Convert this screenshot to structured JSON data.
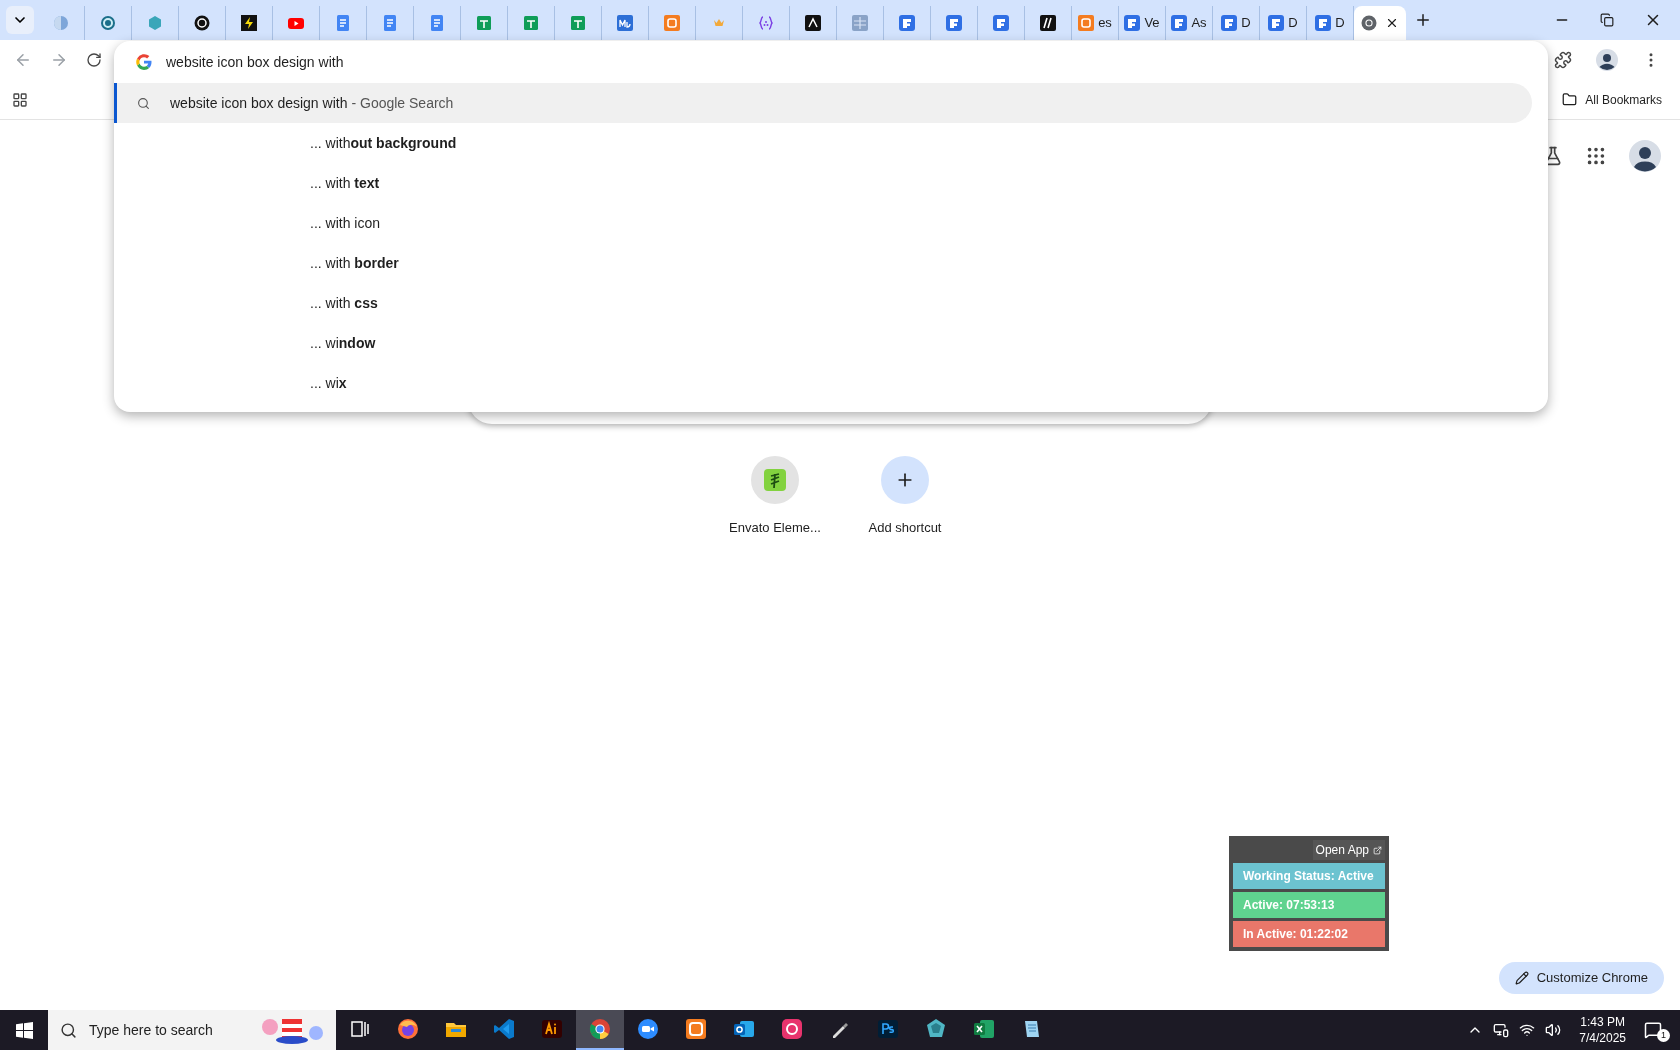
{
  "tabs": [
    {
      "kind": "globe",
      "selected": false
    },
    {
      "kind": "ring",
      "selected": false
    },
    {
      "kind": "hex",
      "selected": false
    },
    {
      "kind": "knot",
      "selected": false
    },
    {
      "kind": "bolt",
      "selected": false
    },
    {
      "kind": "video",
      "selected": false
    },
    {
      "kind": "doc",
      "selected": false
    },
    {
      "kind": "doc",
      "selected": false
    },
    {
      "kind": "doc",
      "selected": false
    },
    {
      "kind": "sheet",
      "selected": false
    },
    {
      "kind": "sheet",
      "selected": false
    },
    {
      "kind": "sheet",
      "selected": false
    },
    {
      "kind": "wave",
      "selected": false
    },
    {
      "kind": "xampp",
      "selected": false
    },
    {
      "kind": "crown",
      "selected": false
    },
    {
      "kind": "braces",
      "selected": false
    },
    {
      "kind": "peak",
      "selected": false
    },
    {
      "kind": "grid",
      "selected": false
    },
    {
      "kind": "form",
      "selected": false
    },
    {
      "kind": "form",
      "selected": false
    },
    {
      "kind": "form",
      "selected": false
    },
    {
      "kind": "slash",
      "selected": false
    },
    {
      "kind": "xampp",
      "label": "es",
      "selected": false
    },
    {
      "kind": "form",
      "label": "Ve",
      "selected": false
    },
    {
      "kind": "form",
      "label": "As",
      "selected": false
    },
    {
      "kind": "form",
      "label": "D",
      "selected": false
    },
    {
      "kind": "form",
      "label": "D",
      "selected": false
    },
    {
      "kind": "form",
      "label": "D",
      "selected": false
    },
    {
      "kind": "chrome",
      "selected": true
    }
  ],
  "omnibox": {
    "value": "website icon box design with",
    "top_suggestion": {
      "query": "website icon box design with",
      "suffix": "- Google Search"
    },
    "suggestions": [
      "... with**out background**",
      "... with **text**",
      "... with icon",
      "... with **border**",
      "... with **css**",
      "... wi**ndow**",
      "... wi**x**"
    ]
  },
  "bookmarks_bar": {
    "all_bookmarks": "All Bookmarks"
  },
  "shortcuts": [
    {
      "kind": "site",
      "label": "Envato Eleme..."
    },
    {
      "kind": "add",
      "label": "Add shortcut"
    }
  ],
  "tracker": {
    "open_app": "Open App",
    "rows": [
      {
        "text": "Working Status: Active",
        "color": "#6cc3d0"
      },
      {
        "text": "Active: 07:53:13",
        "color": "#5fd38f"
      },
      {
        "text": "In Active: 01:22:02",
        "color": "#e9776a"
      }
    ]
  },
  "customize_button": "Customize Chrome",
  "taskbar": {
    "search_placeholder": "Type here to search",
    "apps": [
      {
        "kind": "taskview",
        "selected": false
      },
      {
        "kind": "firefox",
        "selected": false
      },
      {
        "kind": "folder",
        "selected": false
      },
      {
        "kind": "code",
        "selected": false
      },
      {
        "kind": "illustrator",
        "selected": false
      },
      {
        "kind": "chrome",
        "selected": true
      },
      {
        "kind": "zoom",
        "selected": false
      },
      {
        "kind": "xampp",
        "selected": false
      },
      {
        "kind": "mail",
        "selected": false
      },
      {
        "kind": "cloud",
        "selected": false
      },
      {
        "kind": "pen",
        "selected": false
      },
      {
        "kind": "photoshop",
        "selected": false
      },
      {
        "kind": "gem",
        "selected": false
      },
      {
        "kind": "excel",
        "selected": false
      },
      {
        "kind": "notes",
        "selected": false
      }
    ],
    "time": "1:43 PM",
    "date": "7/4/2025",
    "notifications": "1"
  }
}
